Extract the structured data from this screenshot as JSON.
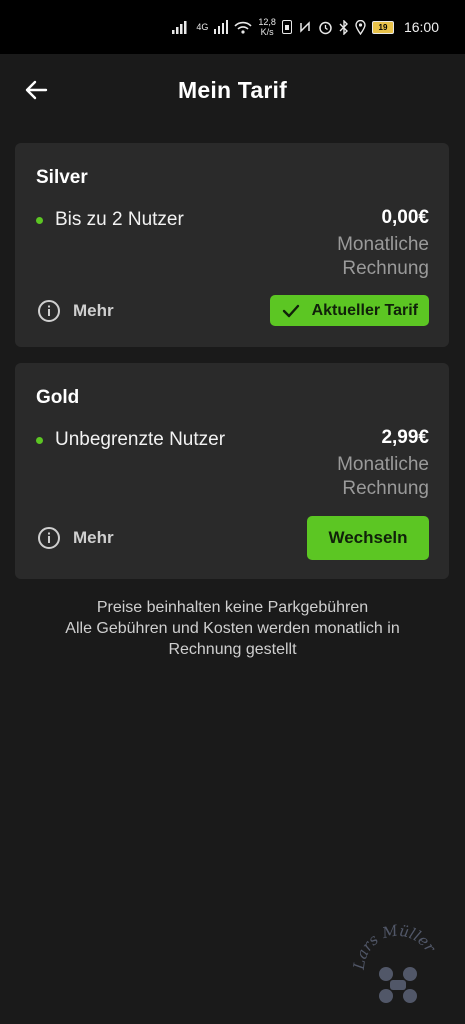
{
  "status_bar": {
    "network": "4G",
    "speed_value": "12,8",
    "speed_unit": "K/s",
    "battery": "19",
    "time": "16:00"
  },
  "header": {
    "title": "Mein Tarif",
    "back_icon": "arrow-left-icon"
  },
  "plans": [
    {
      "name": "Silver",
      "feature": "Bis zu 2 Nutzer",
      "price": "0,00€",
      "billing": "Monatliche Rechnung",
      "more_label": "Mehr",
      "action_label": "Aktueller Tarif",
      "is_current": true
    },
    {
      "name": "Gold",
      "feature": "Unbegrenzte Nutzer",
      "price": "2,99€",
      "billing": "Monatliche Rechnung",
      "more_label": "Mehr",
      "action_label": "Wechseln",
      "is_current": false
    }
  ],
  "footnote": {
    "line1": "Preise beinhalten keine Parkgebühren",
    "line2": "Alle Gebühren und Kosten werden monatlich in",
    "line3": "Rechnung gestellt"
  },
  "watermark": {
    "text": "Lars Müller"
  },
  "colors": {
    "background": "#1a1a1a",
    "card": "#2a2a2a",
    "accent": "#5cc623",
    "muted_text": "#9a9a9a"
  }
}
